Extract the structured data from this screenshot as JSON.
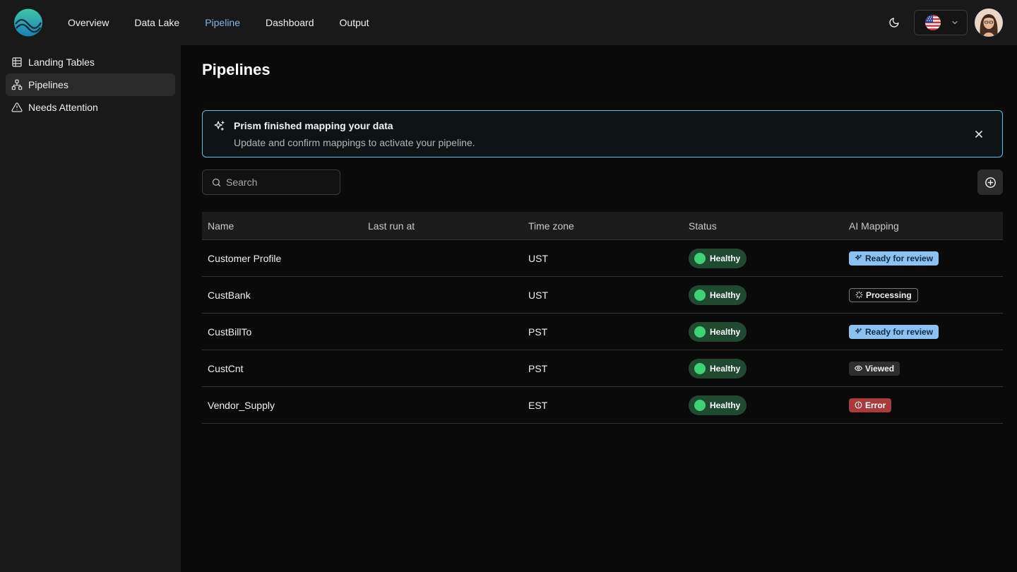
{
  "nav": {
    "items": [
      "Overview",
      "Data Lake",
      "Pipeline",
      "Dashboard",
      "Output"
    ],
    "active": "Pipeline"
  },
  "header_icons": {
    "logo": "wave-logo",
    "theme": "moon-icon",
    "language": "us-flag-icon",
    "language_dropdown": "chevron-down-icon",
    "avatar": "user-avatar"
  },
  "sidebar": {
    "items": [
      {
        "label": "Landing Tables",
        "icon": "table-icon"
      },
      {
        "label": "Pipelines",
        "icon": "network-icon"
      },
      {
        "label": "Needs Attention",
        "icon": "warning-icon"
      }
    ],
    "active": "Pipelines"
  },
  "page": {
    "title": "Pipelines"
  },
  "banner": {
    "icon": "sparkles-icon",
    "title": "Prism finished mapping your data",
    "subtitle": "Update and confirm mappings to activate your pipeline.",
    "close_icon": "close-icon"
  },
  "search": {
    "placeholder": "Search",
    "icon": "search-icon"
  },
  "add_button": {
    "icon": "plus-circle-icon"
  },
  "table": {
    "columns": [
      "Name",
      "Last run at",
      "Time zone",
      "Status",
      "AI Mapping"
    ],
    "rows": [
      {
        "name": "Customer Profile",
        "last_run": "",
        "timezone": "UST",
        "status": "Healthy",
        "ai_mapping": "Ready for review",
        "ai_kind": "review"
      },
      {
        "name": "CustBank",
        "last_run": "",
        "timezone": "UST",
        "status": "Healthy",
        "ai_mapping": "Processing",
        "ai_kind": "processing"
      },
      {
        "name": "CustBillTo",
        "last_run": "",
        "timezone": "PST",
        "status": "Healthy",
        "ai_mapping": "Ready for review",
        "ai_kind": "review"
      },
      {
        "name": "CustCnt",
        "last_run": "",
        "timezone": "PST",
        "status": "Healthy",
        "ai_mapping": "Viewed",
        "ai_kind": "viewed"
      },
      {
        "name": "Vendor_Supply",
        "last_run": "",
        "timezone": "EST",
        "status": "Healthy",
        "ai_mapping": "Error",
        "ai_kind": "error"
      }
    ]
  },
  "colors": {
    "accent_nav": "#7ab8ef",
    "banner_border": "#5bc4e0",
    "healthy_bg": "#1f4a30",
    "healthy_dot": "#3fd178",
    "review_bg": "#8cc2f2",
    "error_bg": "#a83b3b"
  }
}
